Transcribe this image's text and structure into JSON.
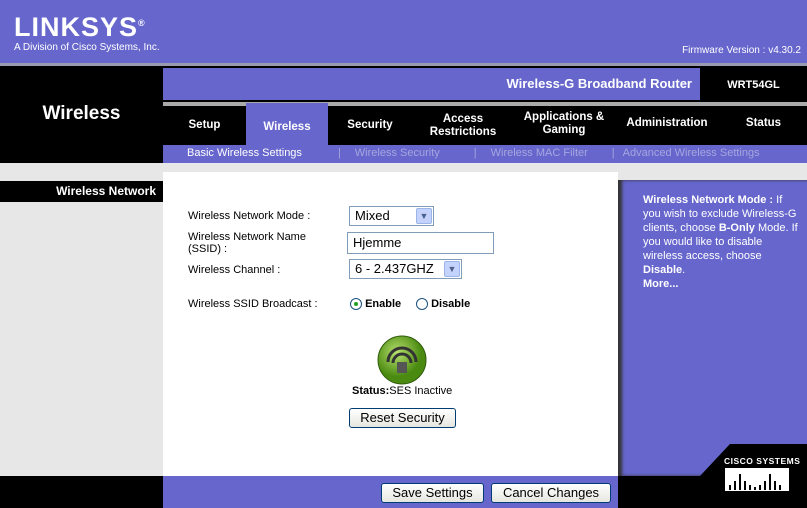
{
  "header": {
    "logo": "LINKSYS",
    "logo_sub": "A Division of Cisco Systems, Inc.",
    "firmware": "Firmware Version : v4.30.2",
    "product": "Wireless-G Broadband Router",
    "model": "WRT54GL",
    "section": "Wireless"
  },
  "tabs": [
    {
      "label": "Setup"
    },
    {
      "label": "Wireless"
    },
    {
      "label": "Security"
    },
    {
      "label": "Access Restrictions"
    },
    {
      "label": "Applications & Gaming"
    },
    {
      "label": "Administration"
    },
    {
      "label": "Status"
    }
  ],
  "subnav": [
    "Basic Wireless Settings",
    "Wireless Security",
    "Wireless MAC Filter",
    "Advanced Wireless Settings"
  ],
  "sidebar": {
    "label": "Wireless Network"
  },
  "form": {
    "mode_label": "Wireless Network Mode :",
    "mode_value": "Mixed",
    "ssid_label": "Wireless Network Name (SSID) :",
    "ssid_value": "Hjemme",
    "channel_label": "Wireless Channel :",
    "channel_value": "6 - 2.437GHZ",
    "broadcast_label": "Wireless SSID Broadcast :",
    "enable": "Enable",
    "disable": "Disable",
    "status_label": "Status:",
    "status_value": "SES Inactive",
    "reset": "Reset Security"
  },
  "help": {
    "title": "Wireless Network Mode :",
    "t1": " If you wish to exclude Wireless-G clients, choose ",
    "b1": "B-Only",
    "t2": " Mode. If you would like to disable wireless access, choose ",
    "b2": "Disable",
    "t3": ".",
    "more": "More..."
  },
  "footer": {
    "save": "Save Settings",
    "cancel": "Cancel Changes",
    "cisco": "CISCO SYSTEMS"
  }
}
